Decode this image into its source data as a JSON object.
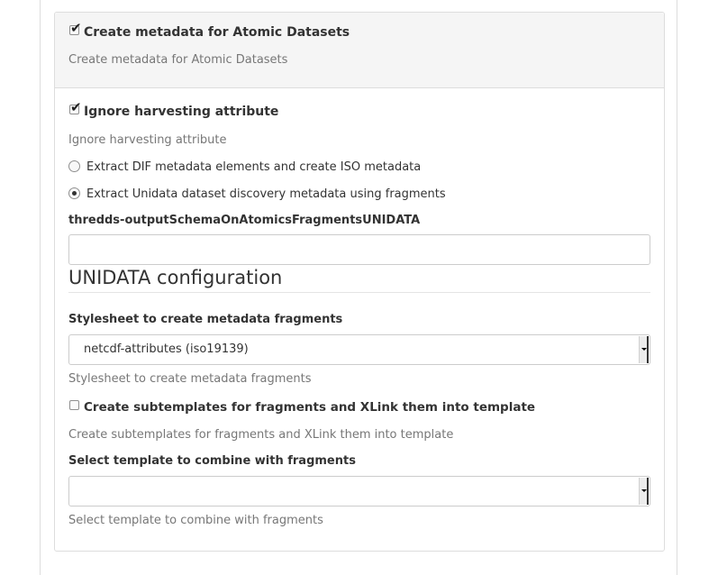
{
  "atomic": {
    "checkbox_label": "Create metadata for Atomic Datasets",
    "help": "Create metadata for Atomic Datasets",
    "checked": true
  },
  "harvesting": {
    "checkbox_label": "Ignore harvesting attribute",
    "help": "Ignore harvesting attribute",
    "checked": true
  },
  "extract_options": [
    {
      "label": "Extract DIF metadata elements and create ISO metadata",
      "selected": false
    },
    {
      "label": "Extract Unidata dataset discovery metadata using fragments",
      "selected": true
    }
  ],
  "output_schema": {
    "label": "thredds-outputSchemaOnAtomicsFragmentsUNIDATA",
    "value": ""
  },
  "section_title": "UNIDATA configuration",
  "stylesheet": {
    "label": "Stylesheet to create metadata fragments",
    "selected": "netcdf-attributes (iso19139)",
    "help": "Stylesheet to create metadata fragments"
  },
  "subtemplates": {
    "checkbox_label": "Create subtemplates for fragments and XLink them into template",
    "help": "Create subtemplates for fragments and XLink them into template",
    "checked": false
  },
  "template": {
    "label": "Select template to combine with fragments",
    "selected": "",
    "help": "Select template to combine with fragments"
  }
}
